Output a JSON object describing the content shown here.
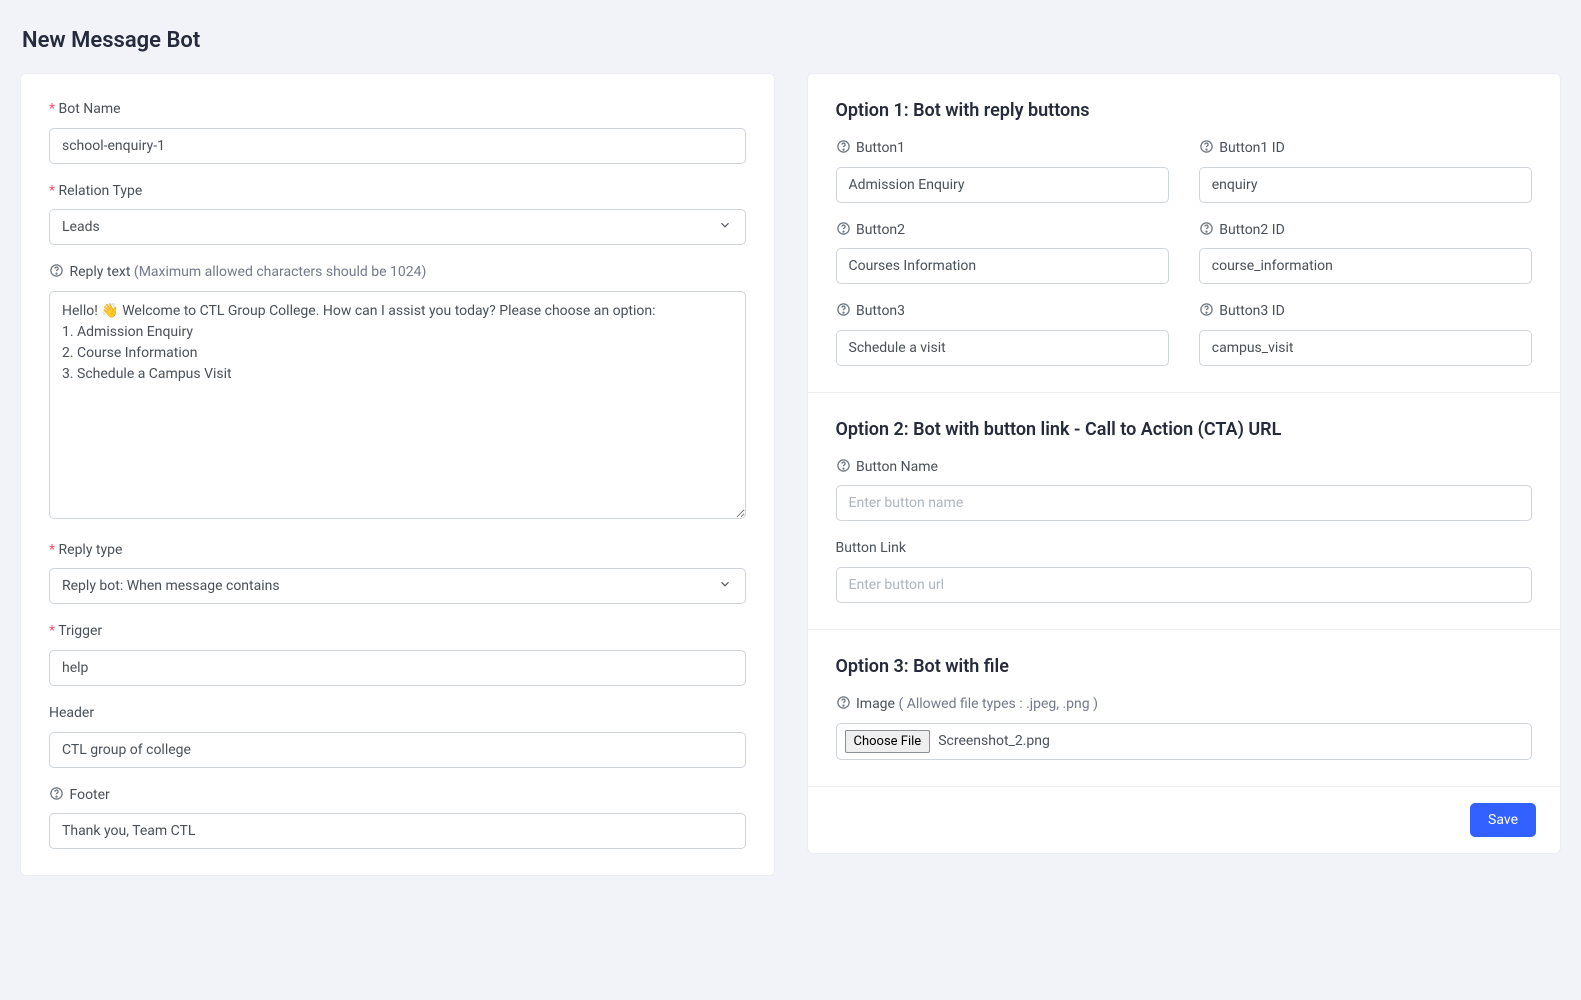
{
  "page_title": "New Message Bot",
  "left": {
    "bot_name_label": "Bot Name",
    "bot_name_value": "school-enquiry-1",
    "relation_type_label": "Relation Type",
    "relation_type_value": "Leads",
    "reply_text_label": "Reply text ",
    "reply_text_hint": "(Maximum allowed characters should be 1024)",
    "reply_text_value": "Hello! 👋 Welcome to CTL Group College. How can I assist you today? Please choose an option:\n1. Admission Enquiry\n2. Course Information\n3. Schedule a Campus Visit",
    "reply_type_label": "Reply type",
    "reply_type_value": "Reply bot: When message contains",
    "trigger_label": "Trigger",
    "trigger_value": "help",
    "header_label": "Header",
    "header_value": "CTL group of college",
    "footer_label": "Footer",
    "footer_value": "Thank you, Team CTL"
  },
  "right": {
    "option1": {
      "title": "Option 1: Bot with reply buttons",
      "button1_label": "Button1",
      "button1_value": "Admission Enquiry",
      "button1_id_label": "Button1 ID",
      "button1_id_value": "enquiry",
      "button2_label": "Button2",
      "button2_value": "Courses Information",
      "button2_id_label": "Button2 ID",
      "button2_id_value": "course_information",
      "button3_label": "Button3",
      "button3_value": "Schedule a visit",
      "button3_id_label": "Button3 ID",
      "button3_id_value": "campus_visit"
    },
    "option2": {
      "title": "Option 2: Bot with button link - Call to Action (CTA) URL",
      "button_name_label": "Button Name",
      "button_name_placeholder": "Enter button name",
      "button_link_label": "Button Link",
      "button_link_placeholder": "Enter button url"
    },
    "option3": {
      "title": "Option 3: Bot with file",
      "image_label": "Image ",
      "image_hint": "( Allowed file types : .jpeg, .png )",
      "choose_file_label": "Choose File",
      "file_name": "Screenshot_2.png"
    },
    "save_label": "Save"
  }
}
